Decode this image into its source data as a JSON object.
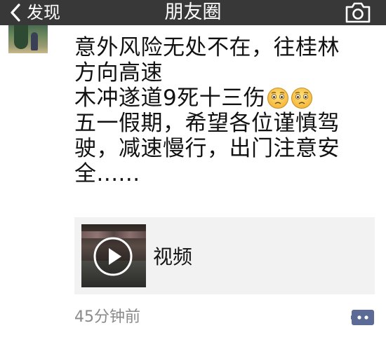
{
  "nav": {
    "back_label": "发现",
    "title": "朋友圈",
    "back_icon": "chevron-left-icon",
    "camera_icon": "camera-icon"
  },
  "post": {
    "lines": [
      "意外风险无处不在，往桂林",
      "方向高速",
      "木冲遂道9死十三伤",
      "五一假期，希望各位谨慎驾",
      "驶，减速慢行，出门注意安",
      "全......"
    ],
    "emoji": "worried-face-icon"
  },
  "link_card": {
    "label": "视频",
    "thumb_icon": "play-icon"
  },
  "footer": {
    "timestamp": "45分钟前",
    "comment_icon": "comment-icon"
  },
  "colors": {
    "navbar_bg": "#383838",
    "card_bg": "#f2f2f2",
    "timestamp": "#8a8a8a",
    "comment_icon": "#5b6b95"
  }
}
